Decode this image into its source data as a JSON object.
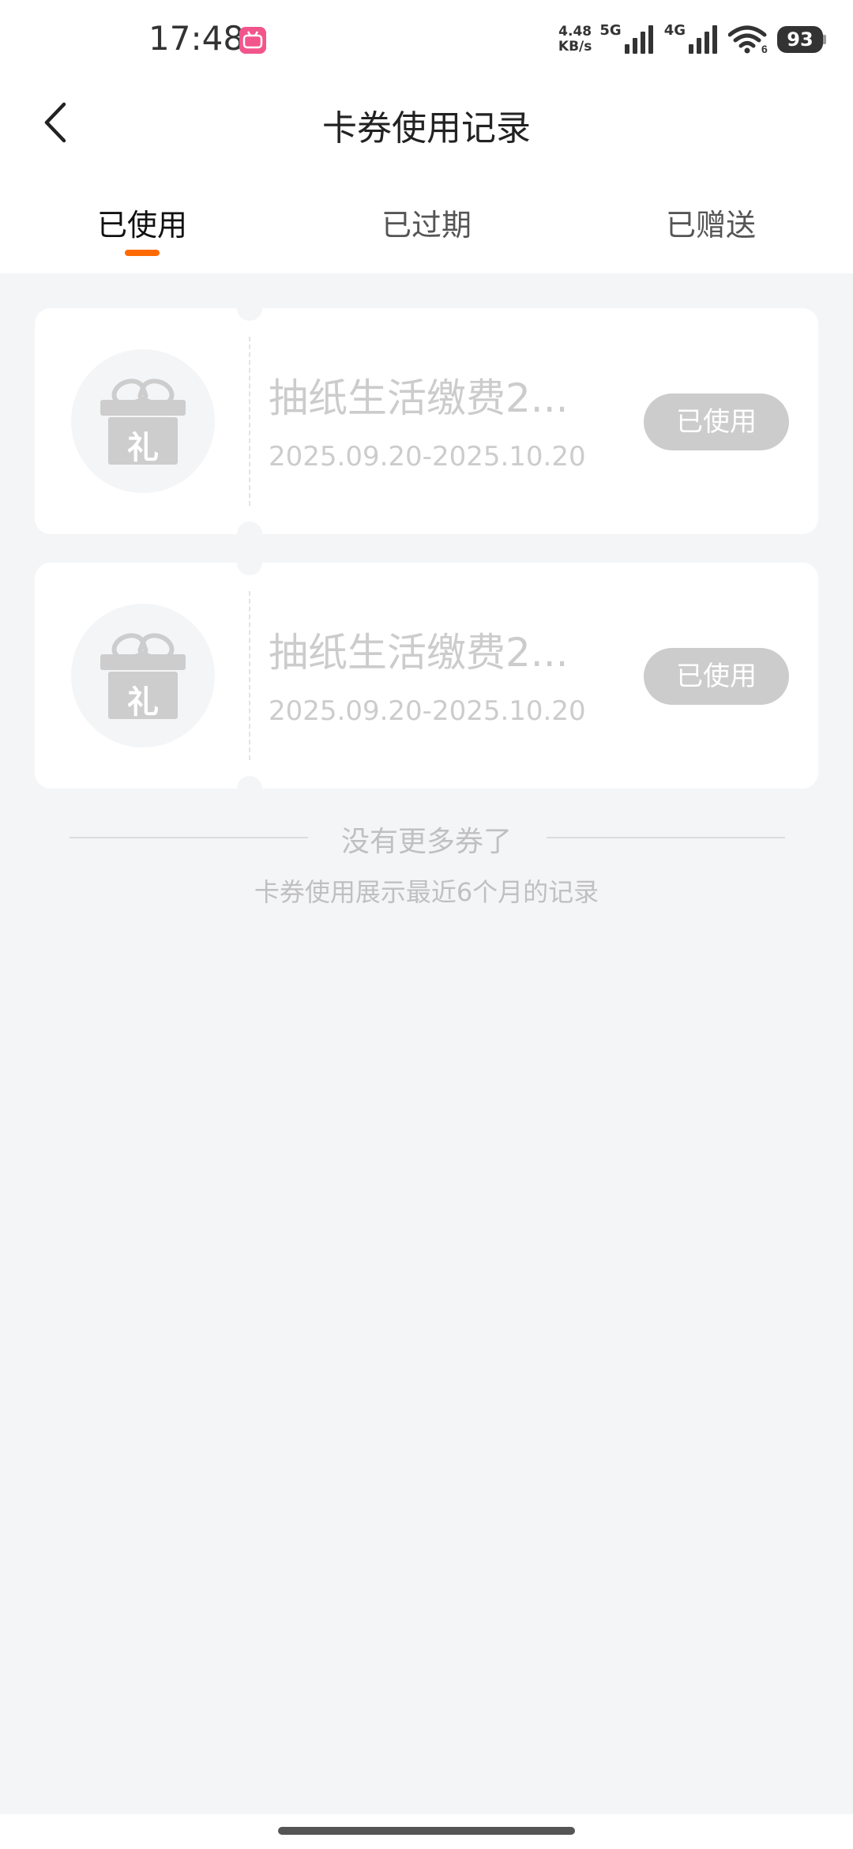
{
  "status_bar": {
    "time": "17:48",
    "app_icon_text": "bilibili",
    "net_speed_value": "4.48",
    "net_speed_unit": "KB/s",
    "network_1": "5G",
    "network_2": "4G",
    "wifi_badge": "6",
    "battery": "93"
  },
  "header": {
    "back_icon": "chevron-left-icon",
    "title": "卡券使用记录"
  },
  "tabs": [
    {
      "label": "已使用",
      "active": true
    },
    {
      "label": "已过期",
      "active": false
    },
    {
      "label": "已赠送",
      "active": false
    }
  ],
  "colors": {
    "accent": "#ff6a00",
    "background": "#f4f5f7",
    "disabled": "#cccccc"
  },
  "coupons": [
    {
      "icon": "gift-icon",
      "icon_char": "礼",
      "title": "抽纸生活缴费2...",
      "date_range": "2025.09.20-2025.10.20",
      "status": "已使用"
    },
    {
      "icon": "gift-icon",
      "icon_char": "礼",
      "title": "抽纸生活缴费2...",
      "date_range": "2025.09.20-2025.10.20",
      "status": "已使用"
    }
  ],
  "footer": {
    "end_text": "没有更多券了",
    "note": "卡券使用展示最近6个月的记录"
  }
}
